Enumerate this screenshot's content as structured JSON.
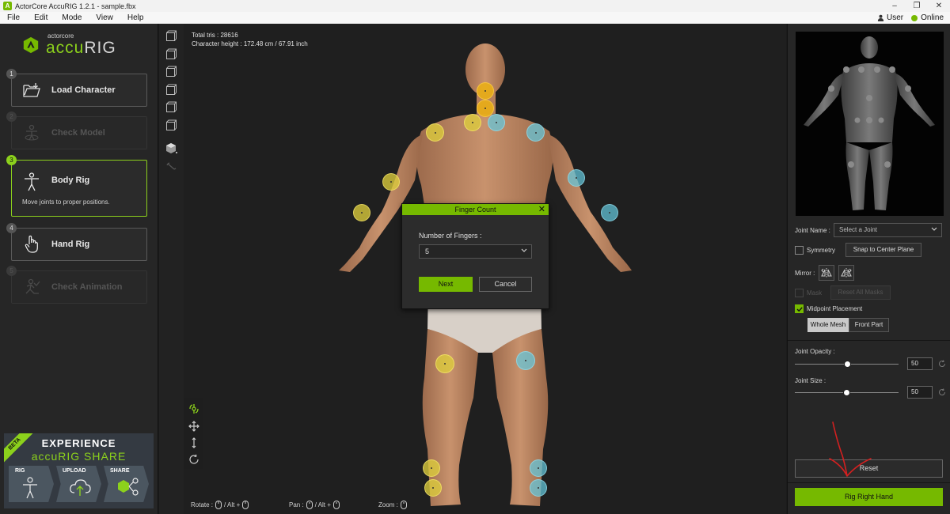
{
  "window": {
    "title": "ActorCore AccuRIG 1.2.1 - sample.fbx",
    "controls": [
      "–",
      "❐",
      "✕"
    ]
  },
  "menu": {
    "items": [
      "File",
      "Edit",
      "Mode",
      "View",
      "Help"
    ],
    "user_label": "User",
    "status_label": "Online"
  },
  "logo": {
    "top": "actorcore",
    "main_a": "accu",
    "main_b": "RIG"
  },
  "steps": [
    {
      "num": "1",
      "label": "Load Character",
      "state": "normal"
    },
    {
      "num": "2",
      "label": "Check Model",
      "state": "disabled"
    },
    {
      "num": "3",
      "label": "Body Rig",
      "state": "active",
      "sub": "Move joints to proper positions."
    },
    {
      "num": "4",
      "label": "Hand Rig",
      "state": "normal"
    },
    {
      "num": "5",
      "label": "Check Animation",
      "state": "disabled"
    }
  ],
  "promo": {
    "badge": "BETA",
    "line1": "EXPERIENCE",
    "line2": "accuRIG SHARE",
    "tiles": [
      "RIG",
      "UPLOAD",
      "SHARE"
    ]
  },
  "viewport": {
    "info_line1": "Total tris : 28616",
    "info_line2": "Character height : 172.48 cm / 67.91 inch",
    "hint_rotate": "Rotate :",
    "hint_pan": "Pan :",
    "hint_zoom": "Zoom :",
    "hint_alt": "/  Alt +"
  },
  "dialog": {
    "title": "Finger Count",
    "label": "Number of Fingers :",
    "value": "5",
    "next": "Next",
    "cancel": "Cancel"
  },
  "right": {
    "joint_name_label": "Joint Name :",
    "joint_name_placeholder": "Select a Joint",
    "symmetry": "Symmetry",
    "snap": "Snap to Center Plane",
    "mirror": "Mirror :",
    "mask": "Mask",
    "reset_masks": "Reset All Masks",
    "midpoint": "Midpoint Placement",
    "whole_mesh": "Whole Mesh",
    "front_part": "Front Part",
    "opacity_label": "Joint Opacity :",
    "opacity_value": "50",
    "size_label": "Joint Size :",
    "size_value": "50",
    "reset": "Reset",
    "rig": "Rig Right Hand"
  },
  "colors": {
    "accent": "#76b900",
    "joint_yellow": "#dccd3c",
    "joint_orange": "#ebaf14",
    "joint_blue": "#64c8dc"
  }
}
